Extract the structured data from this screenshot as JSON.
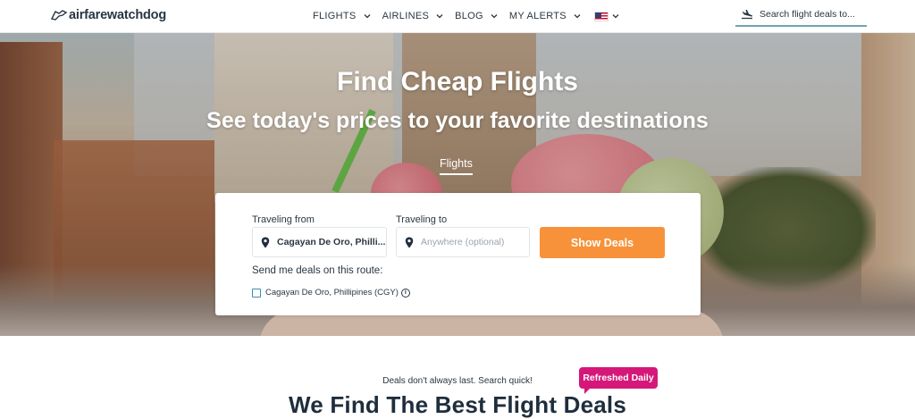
{
  "header": {
    "logo_text": "airfarewatchdog",
    "nav": [
      {
        "label": "FLIGHTS"
      },
      {
        "label": "AIRLINES"
      },
      {
        "label": "BLOG"
      },
      {
        "label": "MY ALERTS"
      }
    ],
    "search_placeholder": "Search flight deals to..."
  },
  "hero": {
    "title": "Find Cheap Flights",
    "subtitle": "See today's prices to your favorite destinations",
    "tab": "Flights"
  },
  "form": {
    "from_label": "Traveling from",
    "from_value": "Cagayan De Oro, Philli...",
    "to_label": "Traveling to",
    "to_placeholder": "Anywhere (optional)",
    "button": "Show Deals",
    "send_deals_label": "Send me deals on this route:",
    "route_option": "Cagayan De Oro, Phillipines (CGY)"
  },
  "below": {
    "note": "Deals don't always last. Search quick!",
    "badge": "Refreshed Daily",
    "heading": "We Find The Best Flight Deals"
  },
  "colors": {
    "accent_orange": "#f7923a",
    "badge_magenta": "#d6177a",
    "text_dark": "#2a3642",
    "search_underline": "#6fa5ae"
  }
}
